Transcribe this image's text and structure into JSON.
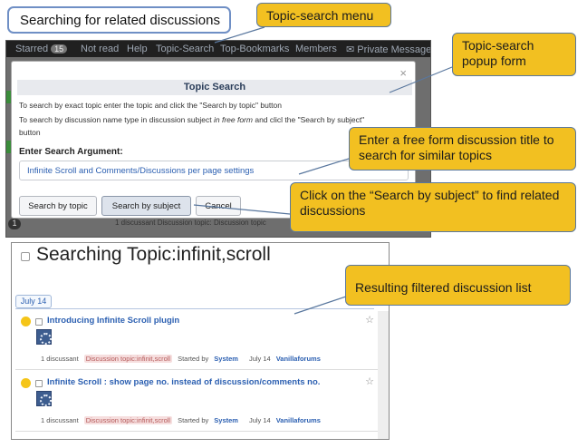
{
  "title_callout": "Searching for related discussions",
  "nav": {
    "starred_label": "Starred",
    "starred_count": "15",
    "not_read": "Not read",
    "help": "Help",
    "topic_search": "Topic-Search",
    "top_bookmarks": "Top-Bookmarks",
    "members": "Members",
    "private_message": "Private Message"
  },
  "modal": {
    "close": "×",
    "title": "Topic Search",
    "help_line1": "To search by exact topic enter the topic and click the \"Search by topic\" button",
    "help_line2_a": "To search by discussion name type in discussion subject ",
    "help_line2_italic": "in free form",
    "help_line2_b": " and clicl the \"Search by subject\"",
    "help_line3": "button",
    "input_label": "Enter Search Argument:",
    "input_value": "Infinite Scroll and Comments/Discussions per page settings",
    "btn_topic": "Search by topic",
    "btn_subject": "Search by subject",
    "btn_cancel": "Cancel"
  },
  "background": {
    "count_badge": "1",
    "faded_row": "1 discussant   Discussion topic: Discussion topic"
  },
  "results": {
    "heading": "Searching Topic:infinit,scroll",
    "date_tab": "July 14",
    "items": [
      {
        "title": "Introducing Infinite Scroll plugin",
        "discussants": "1 discussant",
        "tag": "Discussion topic:infinit,scroll",
        "started_by": "Started by",
        "author": "System",
        "date": "July 14",
        "category": "Vanillaforums"
      },
      {
        "title": "Infinite Scroll : show page no. instead of discussion/comments no.",
        "discussants": "1 discussant",
        "tag": "Discussion topic:infinit,scroll",
        "started_by": "Started by",
        "author": "System",
        "date": "July 14",
        "category": "Vanillaforums"
      }
    ]
  },
  "callouts": {
    "menu": "Topic-search menu",
    "popup": "Topic-search popup form",
    "free_form": "Enter a free form discussion title to search for similar topics",
    "subject": "Click on the “Search by subject” to find related discussions",
    "result": "Resulting filtered discussion list"
  },
  "colors": {
    "callout_fill": "#f2c021",
    "callout_border": "#59779e",
    "link_blue": "#2b5fb1",
    "nav_bg": "#202020"
  },
  "icons": {
    "close": "close-icon",
    "envelope": "envelope-icon",
    "bulb": "bulb-icon",
    "star": "star-icon",
    "avatar": "avatar-icon"
  }
}
